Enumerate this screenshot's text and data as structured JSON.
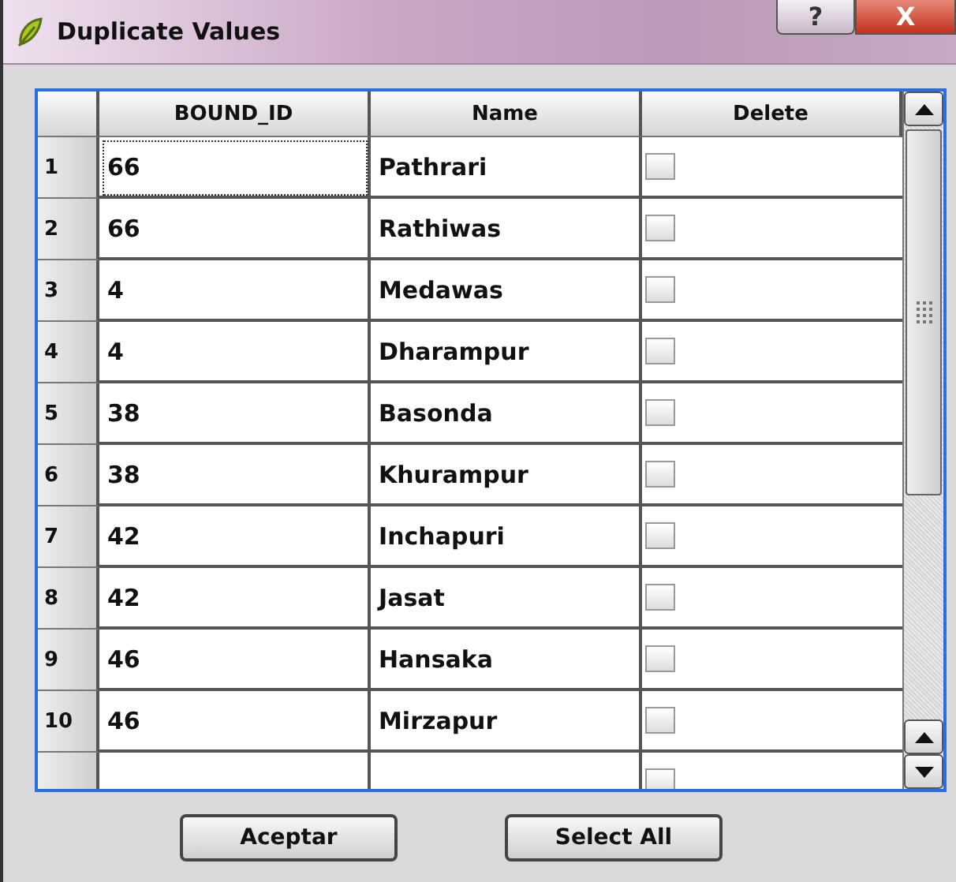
{
  "window": {
    "title": "Duplicate Values",
    "buttons": [
      "?",
      "X"
    ]
  },
  "table": {
    "columns": [
      "BOUND_ID",
      "Name",
      "Delete"
    ],
    "rows": [
      {
        "number": "1",
        "bound_id": "66",
        "name": "Pathrari",
        "delete": false,
        "focused": true
      },
      {
        "number": "2",
        "bound_id": "66",
        "name": "Rathiwas",
        "delete": false,
        "focused": false
      },
      {
        "number": "3",
        "bound_id": "4",
        "name": "Medawas",
        "delete": false,
        "focused": false
      },
      {
        "number": "4",
        "bound_id": "4",
        "name": "Dharampur",
        "delete": false,
        "focused": false
      },
      {
        "number": "5",
        "bound_id": "38",
        "name": "Basonda",
        "delete": false,
        "focused": false
      },
      {
        "number": "6",
        "bound_id": "38",
        "name": "Khurampur",
        "delete": false,
        "focused": false
      },
      {
        "number": "7",
        "bound_id": "42",
        "name": "Inchapuri",
        "delete": false,
        "focused": false
      },
      {
        "number": "8",
        "bound_id": "42",
        "name": "Jasat",
        "delete": false,
        "focused": false
      },
      {
        "number": "9",
        "bound_id": "46",
        "name": "Hansaka",
        "delete": false,
        "focused": false
      },
      {
        "number": "10",
        "bound_id": "46",
        "name": "Mirzapur",
        "delete": false,
        "focused": false
      }
    ],
    "cut_row": {
      "delete": false
    }
  },
  "buttons": [
    "Aceptar",
    "Select All"
  ]
}
